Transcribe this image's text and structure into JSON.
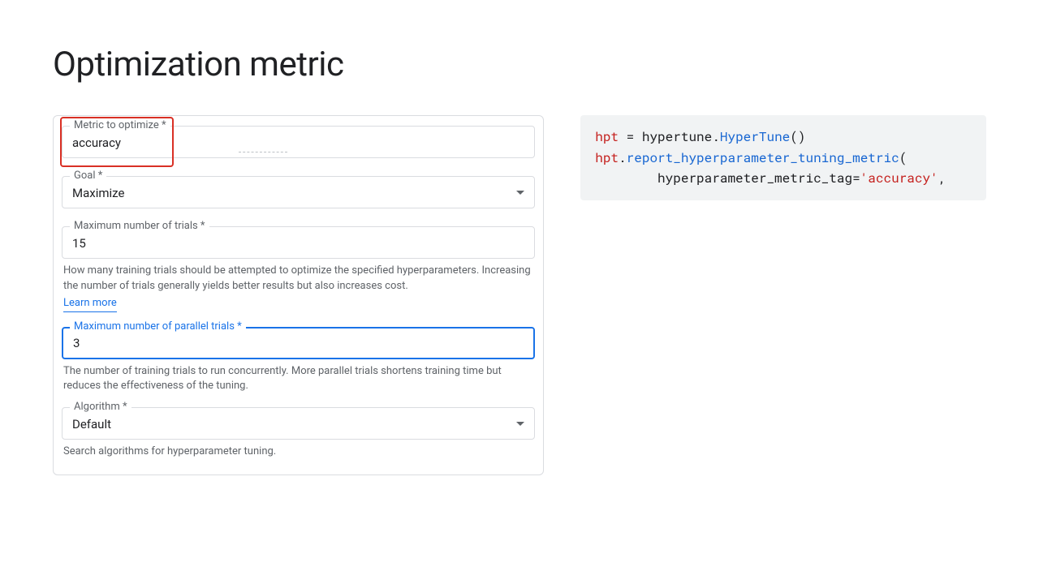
{
  "title": "Optimization metric",
  "form": {
    "metric": {
      "label": "Metric to optimize *",
      "value": "accuracy"
    },
    "goal": {
      "label": "Goal *",
      "value": "Maximize"
    },
    "maxTrials": {
      "label": "Maximum number of trials *",
      "value": "15",
      "helper": "How many training trials should be attempted to optimize the specified hyperparameters. Increasing the number of trials generally yields better results but also increases cost.",
      "learnMore": "Learn more"
    },
    "maxParallel": {
      "label": "Maximum number of parallel trials *",
      "value": "3",
      "helper": "The number of training trials to run concurrently. More parallel trials shortens training time but reduces the effectiveness of the tuning."
    },
    "algorithm": {
      "label": "Algorithm *",
      "value": "Default",
      "helper": "Search algorithms for hyperparameter tuning."
    }
  },
  "code": {
    "l1": {
      "v": "hpt",
      "rest": " = hypertune.",
      "fn": "HyperTune",
      "tail": "()"
    },
    "l2": {
      "v": "hpt",
      "dot": ".",
      "fn": "report_hyperparameter_tuning_metric",
      "tail": "("
    },
    "l3": {
      "indent": "        hyperparameter_metric_tag=",
      "q1": "'",
      "str": "accuracy",
      "q2": "'",
      "tail": ","
    }
  }
}
